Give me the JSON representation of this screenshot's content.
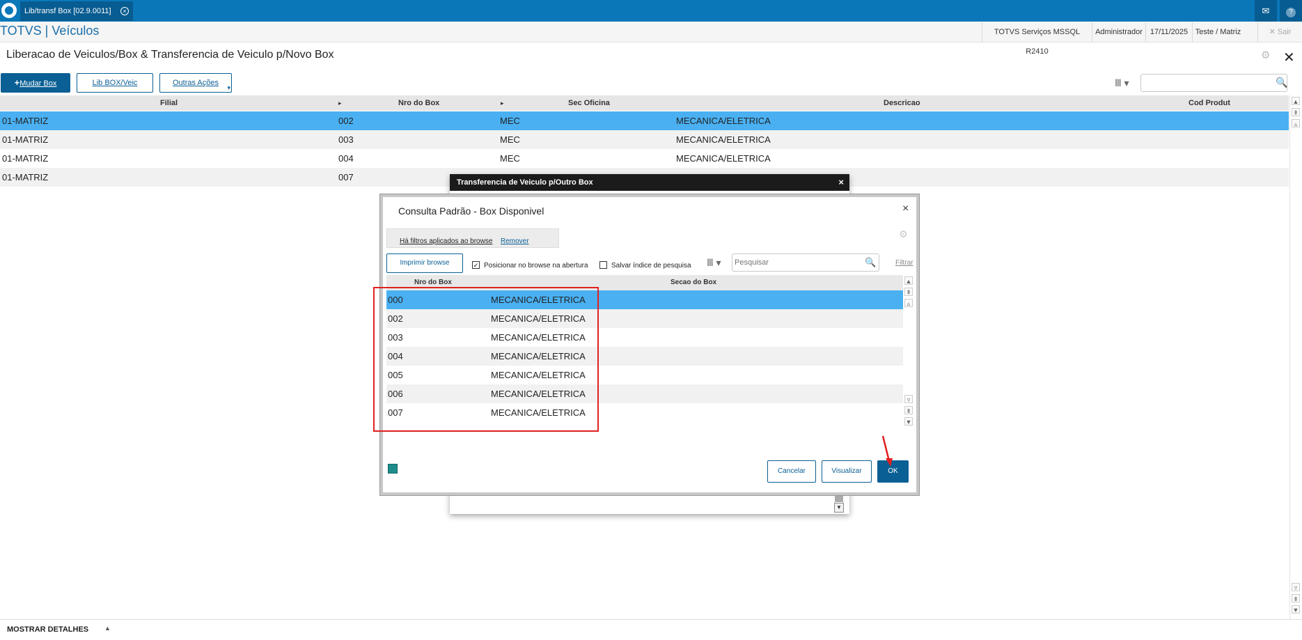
{
  "topbar": {
    "tab_label": "Lib/transf Box [02.9.0011]",
    "tab_close": "×",
    "mail_icon": "✉",
    "help_icon": "?"
  },
  "header": {
    "brand": "TOTVS | Veículos",
    "info": [
      "TOTVS Serviços MSSQL R2410",
      "Administrador",
      "17/11/2025",
      "Teste / Matriz"
    ],
    "sair": "Sair",
    "sair_icon": "✕"
  },
  "page": {
    "title": "Liberacao de Veiculos/Box & Transferencia de Veiculo p/Novo Box",
    "gear_icon": "⚙",
    "close_icon": "✕"
  },
  "toolbar": {
    "mudar_box": "Mudar Box",
    "plus": "+",
    "lib_box": "Lib BOX/Veic",
    "outras": "Outras Ações",
    "caret": "▾",
    "column_icon": "Ⅲ ▾",
    "search_icon": "🔍"
  },
  "grid": {
    "columns": [
      "Filial",
      "Nro do Box",
      "Sec Oficina",
      "Descricao",
      "Cod Produt"
    ],
    "sort_arrow": "▸",
    "rows": [
      [
        "01-MATRIZ",
        "002",
        "MEC",
        "MECANICA/ELETRICA"
      ],
      [
        "01-MATRIZ",
        "003",
        "MEC",
        "MECANICA/ELETRICA"
      ],
      [
        "01-MATRIZ",
        "004",
        "MEC",
        "MECANICA/ELETRICA"
      ],
      [
        "01-MATRIZ",
        "007",
        "",
        ""
      ]
    ]
  },
  "scroll": {
    "up": "▲",
    "up2": "⇞",
    "up3": "▵",
    "down": "▼",
    "down2": "⇟",
    "down3": "▿"
  },
  "footer": {
    "label": "MOSTRAR DETALHES",
    "arrow": "▲"
  },
  "transfer_dialog": {
    "title": "Transferencia de Veiculo p/Outro Box",
    "close": "×",
    "scroll_down": "▼"
  },
  "consulta_dialog": {
    "title": "Consulta Padrão - Box Disponivel",
    "close": "×",
    "filter_msg": "Há filtros aplicados ao browse",
    "filter_remove": "Remover",
    "gear_icon": "⚙",
    "print_btn": "Imprimir browse",
    "chk1_label": "Posicionar no browse na abertura",
    "chk1_mark": "✓",
    "chk2_label": "Salvar índice de pesquisa",
    "column_icon": "Ⅲ ▾",
    "search_placeholder": "Pesquisar",
    "search_icon": "🔍",
    "filtrar": "Filtrar",
    "columns": [
      "Nro do Box",
      "Secao do Box"
    ],
    "rows": [
      [
        "000",
        "MECANICA/ELETRICA"
      ],
      [
        "002",
        "MECANICA/ELETRICA"
      ],
      [
        "003",
        "MECANICA/ELETRICA"
      ],
      [
        "004",
        "MECANICA/ELETRICA"
      ],
      [
        "005",
        "MECANICA/ELETRICA"
      ],
      [
        "006",
        "MECANICA/ELETRICA"
      ],
      [
        "007",
        "MECANICA/ELETRICA"
      ]
    ],
    "cancel": "Cancelar",
    "visualizar": "Visualizar",
    "ok": "OK"
  },
  "colors": {
    "brand_blue": "#0a77b8",
    "primary_button": "#0a5f94",
    "selected_row": "#4ab0f2",
    "highlight": "#e02020"
  }
}
